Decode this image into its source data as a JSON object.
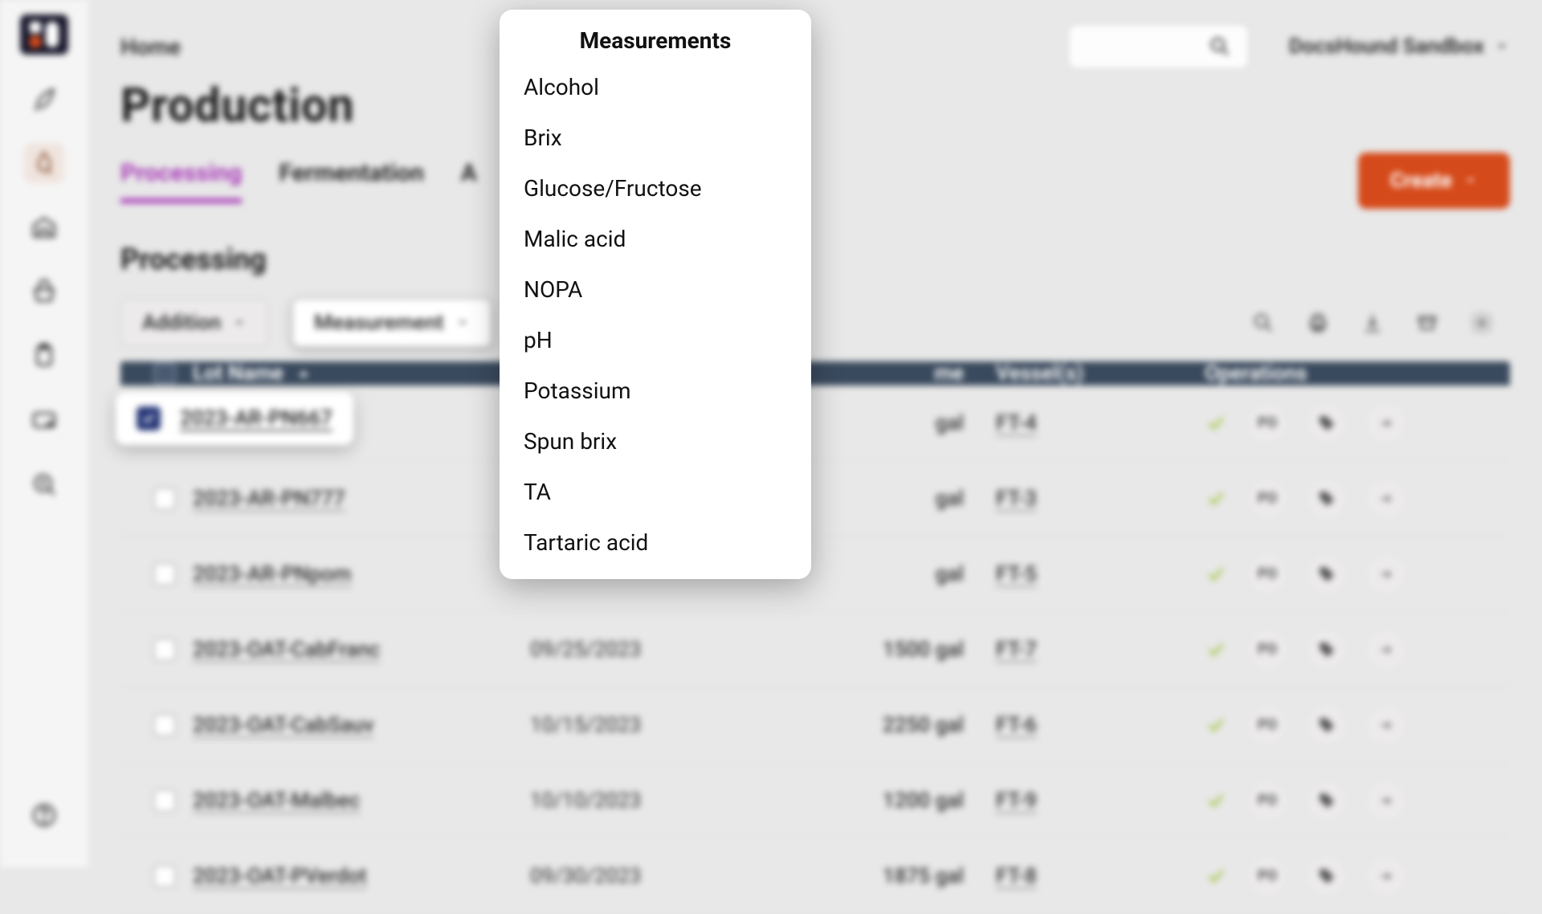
{
  "breadcrumb": {
    "home": "Home"
  },
  "page_title": "Production",
  "tabs": [
    "Processing",
    "Fermentation",
    "A"
  ],
  "active_tab": 0,
  "tenant": "DocsHound Sandbox",
  "create_label": "Create",
  "section_title": "Processing",
  "toolbar": {
    "addition_label": "Addition",
    "measurement_label": "Measurement"
  },
  "columns": {
    "lot": "Lot Name",
    "date": "",
    "volume": "me",
    "vessel": "Vessel(s)",
    "ops": "Operations"
  },
  "rows": [
    {
      "checked": true,
      "lot": "2023-AR-PN667",
      "date": "",
      "volume": "gal",
      "vessel": "FT-4",
      "po": "PO"
    },
    {
      "checked": false,
      "lot": "2023-AR-PN777",
      "date": "",
      "volume": "gal",
      "vessel": "FT-3",
      "po": "PO"
    },
    {
      "checked": false,
      "lot": "2023-AR-PNpom",
      "date": "",
      "volume": "gal",
      "vessel": "FT-5",
      "po": "PO"
    },
    {
      "checked": false,
      "lot": "2023-OAT-CabFranc",
      "date": "09/25/2023",
      "volume": "1500 gal",
      "vessel": "FT-7",
      "po": "PO"
    },
    {
      "checked": false,
      "lot": "2023-OAT-CabSauv",
      "date": "10/15/2023",
      "volume": "2250 gal",
      "vessel": "FT-6",
      "po": "PO"
    },
    {
      "checked": false,
      "lot": "2023-OAT-Malbec",
      "date": "10/10/2023",
      "volume": "1200 gal",
      "vessel": "FT-9",
      "po": "PO"
    },
    {
      "checked": false,
      "lot": "2023-OAT-PVerdot",
      "date": "09/30/2023",
      "volume": "1875 gal",
      "vessel": "FT-8",
      "po": "PO"
    }
  ],
  "popup": {
    "title": "Measurements",
    "items": [
      "Alcohol",
      "Brix",
      "Glucose/Fructose",
      "Malic acid",
      "NOPA",
      "pH",
      "Potassium",
      "Spun brix",
      "TA",
      "Tartaric acid"
    ]
  }
}
